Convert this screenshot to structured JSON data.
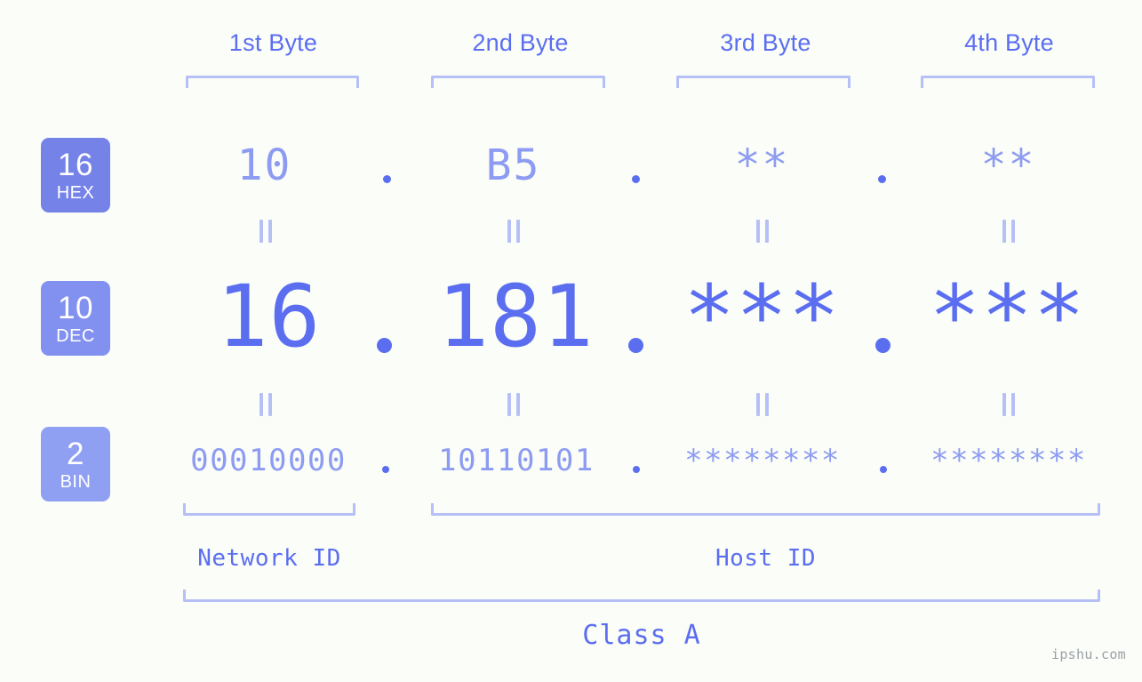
{
  "page": {
    "background_color": "#fbfdf8",
    "accent_color": "#5b6ef0",
    "accent_light_color": "#8d9cf2",
    "bracket_color": "#b6c0f7",
    "watermark": "ipshu.com"
  },
  "byte_headers": [
    {
      "label": "1st Byte"
    },
    {
      "label": "2nd Byte"
    },
    {
      "label": "3rd Byte"
    },
    {
      "label": "4th Byte"
    }
  ],
  "rows": [
    {
      "badge": {
        "number": "16",
        "name": "HEX",
        "color": "#7583e8"
      },
      "base": 16,
      "values": [
        "10",
        "B5",
        "**",
        "**"
      ],
      "separator": "."
    },
    {
      "badge": {
        "number": "10",
        "name": "DEC",
        "color": "#8291ef"
      },
      "base": 10,
      "values": [
        "16",
        "181",
        "***",
        "***"
      ],
      "separator": "."
    },
    {
      "badge": {
        "number": "2",
        "name": "BIN",
        "color": "#8fa0f2"
      },
      "base": 2,
      "values": [
        "00010000",
        "10110101",
        "********",
        "********"
      ],
      "separator": "."
    }
  ],
  "equality_marker": "||",
  "segments": {
    "network_id": "Network ID",
    "host_id": "Host ID",
    "class": "Class A"
  }
}
